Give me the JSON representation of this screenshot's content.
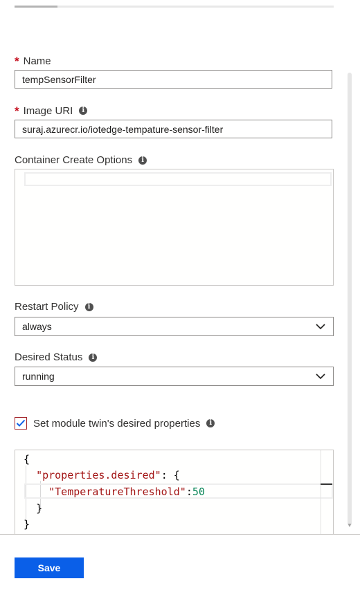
{
  "form": {
    "name": {
      "label": "Name",
      "required_mark": "*",
      "value": "tempSensorFilter"
    },
    "image_uri": {
      "label": "Image URI",
      "required_mark": "*",
      "value": "suraj.azurecr.io/iotedge-tempature-sensor-filter"
    },
    "container_create_options": {
      "label": "Container Create Options"
    },
    "restart_policy": {
      "label": "Restart Policy",
      "selected": "always"
    },
    "desired_status": {
      "label": "Desired Status",
      "selected": "running"
    },
    "twin_checkbox": {
      "label": "Set module twin's desired properties",
      "checked": true
    },
    "twin_json": {
      "line1": "{",
      "line2_key": "\"properties.desired\"",
      "line2_rest": ": {",
      "line3_key": "\"TemperatureThreshold\"",
      "line3_colon": ":",
      "line3_value": "50",
      "line4": "}",
      "line5": "}"
    }
  },
  "info_icon_glyph": "i",
  "footer": {
    "save_label": "Save"
  },
  "colors": {
    "accent": "#0a5fe8",
    "required": "#c50f1f",
    "json_string": "#a31515",
    "json_number": "#098658"
  }
}
